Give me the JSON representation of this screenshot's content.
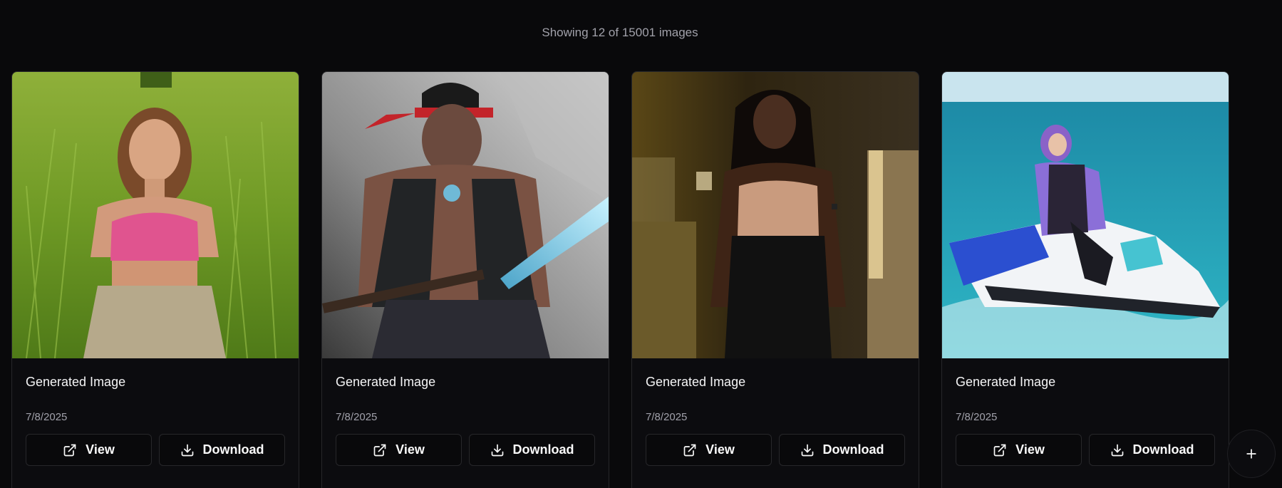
{
  "summary": "Showing 12 of 15001 images",
  "cards": [
    {
      "title": "Generated Image",
      "date": "7/8/2025",
      "view_label": "View",
      "download_label": "Download"
    },
    {
      "title": "Generated Image",
      "date": "7/8/2025",
      "view_label": "View",
      "download_label": "Download"
    },
    {
      "title": "Generated Image",
      "date": "7/8/2025",
      "view_label": "View",
      "download_label": "Download"
    },
    {
      "title": "Generated Image",
      "date": "7/8/2025",
      "view_label": "View",
      "download_label": "Download"
    }
  ],
  "icons": {
    "view": "external-link-icon",
    "download": "download-icon",
    "fab": "plus-icon"
  },
  "colors": {
    "background": "#09090b",
    "card": "#0c0c0f",
    "border": "#27272a",
    "muted_text": "#a1a1aa"
  }
}
